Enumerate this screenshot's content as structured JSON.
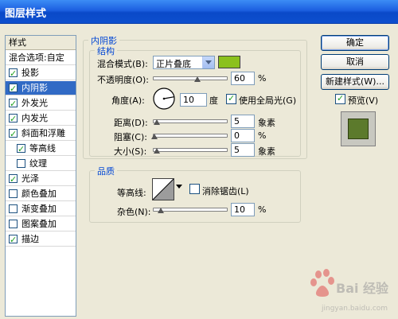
{
  "window": {
    "title": "图层样式"
  },
  "sidebar": {
    "header": "样式",
    "blend_options": "混合选项:自定",
    "items": [
      {
        "label": "投影",
        "checked": true,
        "selected": false,
        "indent": false
      },
      {
        "label": "内阴影",
        "checked": true,
        "selected": true,
        "indent": false
      },
      {
        "label": "外发光",
        "checked": true,
        "selected": false,
        "indent": false
      },
      {
        "label": "内发光",
        "checked": true,
        "selected": false,
        "indent": false
      },
      {
        "label": "斜面和浮雕",
        "checked": true,
        "selected": false,
        "indent": false
      },
      {
        "label": "等高线",
        "checked": true,
        "selected": false,
        "indent": true
      },
      {
        "label": "纹理",
        "checked": false,
        "selected": false,
        "indent": true
      },
      {
        "label": "光泽",
        "checked": true,
        "selected": false,
        "indent": false
      },
      {
        "label": "颜色叠加",
        "checked": false,
        "selected": false,
        "indent": false
      },
      {
        "label": "渐变叠加",
        "checked": false,
        "selected": false,
        "indent": false
      },
      {
        "label": "图案叠加",
        "checked": false,
        "selected": false,
        "indent": false
      },
      {
        "label": "描边",
        "checked": true,
        "selected": false,
        "indent": false
      }
    ]
  },
  "panel": {
    "title": "内阴影",
    "structure": {
      "title": "结构",
      "blend_mode_label": "混合模式(B):",
      "blend_mode_value": "正片叠底",
      "blend_color": "#8BC11D",
      "opacity_label": "不透明度(O):",
      "opacity_value": "60",
      "opacity_unit": "%",
      "angle_label": "角度(A):",
      "angle_value": "10",
      "angle_unit": "度",
      "global_light_label": "使用全局光(G)",
      "global_light_checked": true,
      "distance_label": "距离(D):",
      "distance_value": "5",
      "distance_unit": "象素",
      "choke_label": "阻塞(C):",
      "choke_value": "0",
      "choke_unit": "%",
      "size_label": "大小(S):",
      "size_value": "5",
      "size_unit": "象素"
    },
    "quality": {
      "title": "品质",
      "contour_label": "等高线:",
      "antialias_label": "消除锯齿(L)",
      "antialias_checked": false,
      "noise_label": "杂色(N):",
      "noise_value": "10",
      "noise_unit": "%"
    }
  },
  "actions": {
    "ok": "确定",
    "cancel": "取消",
    "new_style": "新建样式(W)...",
    "preview_label": "预览(V)",
    "preview_checked": true
  },
  "watermark": {
    "text": "Bai 经验",
    "subtext": "jingyan.baidu.com"
  },
  "colors": {
    "title_bar": "#0A49C8",
    "selection": "#316AC5",
    "preview_swatch": "#5C7A2C"
  }
}
